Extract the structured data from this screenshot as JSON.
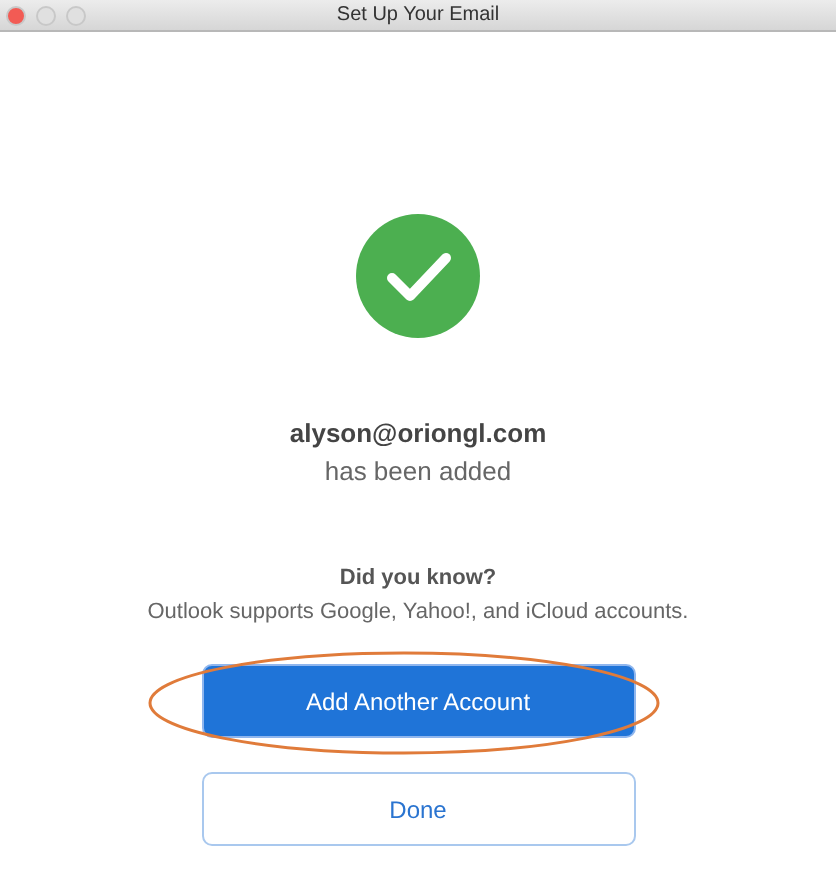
{
  "window": {
    "title": "Set Up Your Email"
  },
  "status": {
    "kind": "success"
  },
  "account": {
    "email": "alyson@oriongl.com",
    "message": "has been added"
  },
  "tip": {
    "heading": "Did you know?",
    "text": "Outlook supports Google, Yahoo!, and iCloud accounts."
  },
  "buttons": [
    {
      "label": "Add Another Account",
      "kind": "primary",
      "highlighted": true
    },
    {
      "label": "Done",
      "kind": "secondary",
      "highlighted": false
    }
  ]
}
